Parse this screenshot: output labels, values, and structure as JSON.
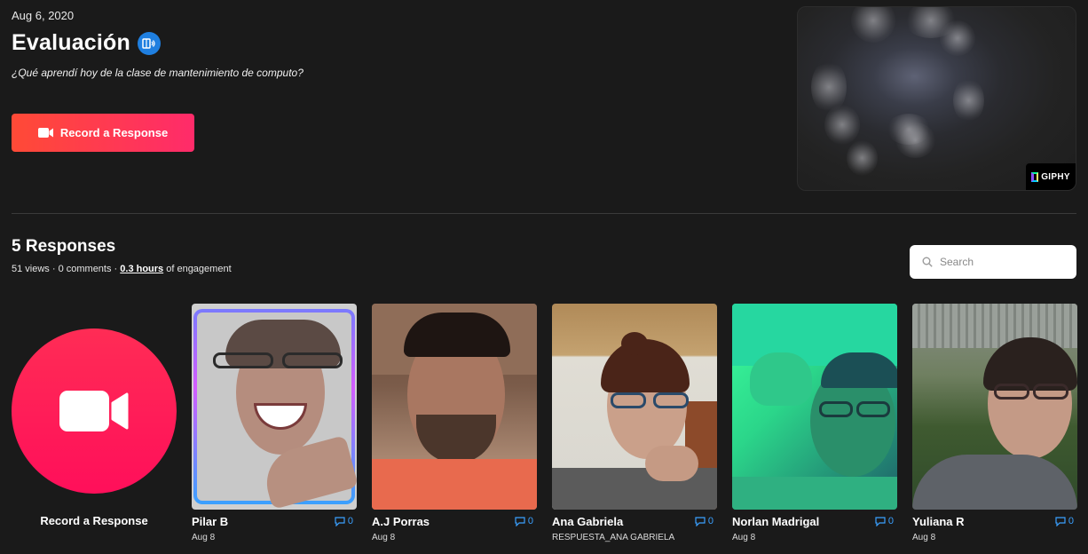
{
  "topic": {
    "date": "Aug 6, 2020",
    "title": "Evaluación",
    "prompt": "¿Qué aprendí hoy de la clase de mantenimiento de computo?",
    "record_button_label": "Record a Response"
  },
  "media": {
    "badge": "GIPHY"
  },
  "responses_section": {
    "title": "5 Responses",
    "stats_prefix": "51 views · 0 comments · ",
    "hours": "0.3 hours",
    "stats_suffix": " of engagement",
    "search_placeholder": "Search",
    "record_label": "Record a Response"
  },
  "responses": [
    {
      "name": "Pilar B",
      "subtitle": "Aug 8",
      "comments": "0"
    },
    {
      "name": "A.J Porras",
      "subtitle": "Aug 8",
      "comments": "0"
    },
    {
      "name": "Ana Gabriela",
      "subtitle": "RESPUESTA_ANA GABRIELA",
      "comments": "0"
    },
    {
      "name": "Norlan Madrigal",
      "subtitle": "Aug 8",
      "comments": "0"
    },
    {
      "name": "Yuliana R",
      "subtitle": "Aug 8",
      "comments": "0"
    }
  ],
  "colors": {
    "accent": "#ff2c55",
    "link": "#3aa0ff",
    "background": "#1a1a1a"
  }
}
